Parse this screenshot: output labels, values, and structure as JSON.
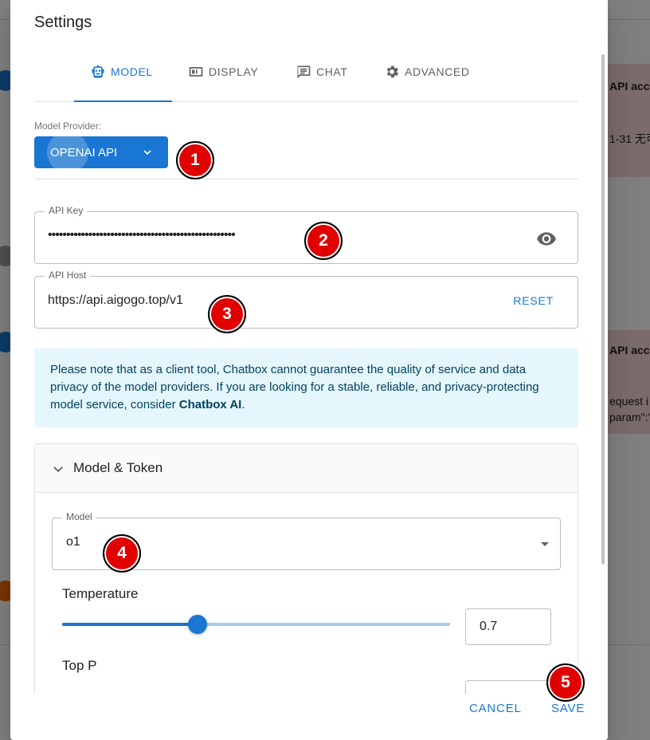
{
  "background": {
    "messages": [
      {
        "text": "API acc"
      },
      {
        "text": "1-31 无可"
      },
      {
        "text": "API acc"
      },
      {
        "text": "equest i"
      },
      {
        "text": "param\":\""
      }
    ]
  },
  "dialog": {
    "title": "Settings",
    "tabs": [
      {
        "label": "MODEL",
        "icon": "robot-icon"
      },
      {
        "label": "DISPLAY",
        "icon": "display-icon"
      },
      {
        "label": "CHAT",
        "icon": "chat-icon"
      },
      {
        "label": "ADVANCED",
        "icon": "gear-icon"
      }
    ],
    "active_tab": "MODEL",
    "model_provider": {
      "label": "Model Provider:",
      "value": "OPENAI API"
    },
    "api_key": {
      "label": "API Key",
      "value": "•••••••••••••••••••••••••••••••••••••••••••••••••••"
    },
    "api_host": {
      "label": "API Host",
      "value": "https://api.aigogo.top/v1",
      "reset_label": "RESET"
    },
    "notice": {
      "text": "Please note that as a client tool, Chatbox cannot guarantee the quality of service and data privacy of the model providers. If you are looking for a stable, reliable, and privacy-protecting model service, consider ",
      "link": "Chatbox AI",
      "suffix": "."
    },
    "model_token": {
      "title": "Model & Token",
      "model_label": "Model",
      "model_value": "o1",
      "temperature_label": "Temperature",
      "temperature_value": "0.7",
      "temperature_fraction": 0.35,
      "top_p_label": "Top P"
    },
    "actions": {
      "cancel_label": "CANCEL",
      "save_label": "SAVE"
    }
  },
  "markers": [
    "1",
    "2",
    "3",
    "4",
    "5"
  ],
  "colors": {
    "accent": "#1976d2",
    "marker": "#e00000",
    "notice_bg": "#e5f6fd"
  }
}
